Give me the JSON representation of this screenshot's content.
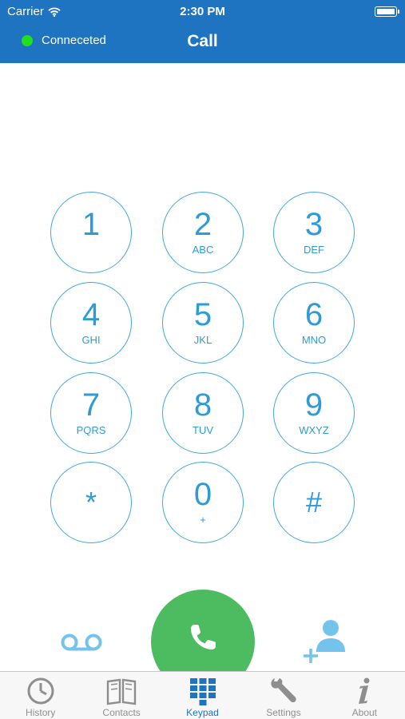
{
  "status_bar": {
    "carrier": "Carrier",
    "time": "2:30 PM"
  },
  "nav": {
    "connection_status": "Conneceted",
    "title": "Call"
  },
  "keys": [
    {
      "digit": "1",
      "letters": ""
    },
    {
      "digit": "2",
      "letters": "ABC"
    },
    {
      "digit": "3",
      "letters": "DEF"
    },
    {
      "digit": "4",
      "letters": "GHI"
    },
    {
      "digit": "5",
      "letters": "JKL"
    },
    {
      "digit": "6",
      "letters": "MNO"
    },
    {
      "digit": "7",
      "letters": "PQRS"
    },
    {
      "digit": "8",
      "letters": "TUV"
    },
    {
      "digit": "9",
      "letters": "WXYZ"
    },
    {
      "digit": "*",
      "letters": ""
    },
    {
      "digit": "0",
      "letters": "+"
    },
    {
      "digit": "#",
      "letters": ""
    }
  ],
  "actions": {
    "voicemail_icon": "voicemail-icon",
    "call_icon": "phone-icon",
    "add_contact_icon": "add-contact-icon"
  },
  "tabs": [
    {
      "label": "History",
      "icon": "clock-icon",
      "active": false
    },
    {
      "label": "Contacts",
      "icon": "book-icon",
      "active": false
    },
    {
      "label": "Keypad",
      "icon": "keypad-icon",
      "active": true
    },
    {
      "label": "Settings",
      "icon": "wrench-icon",
      "active": false
    },
    {
      "label": "About",
      "icon": "info-icon",
      "active": false
    }
  ],
  "colors": {
    "header": "#1f74c2",
    "key_accent": "#2f9bd6",
    "call_green": "#4dbb5f",
    "connected_dot": "#22e01d",
    "tab_active": "#1f74c2",
    "tab_inactive": "#8e8e8e"
  }
}
